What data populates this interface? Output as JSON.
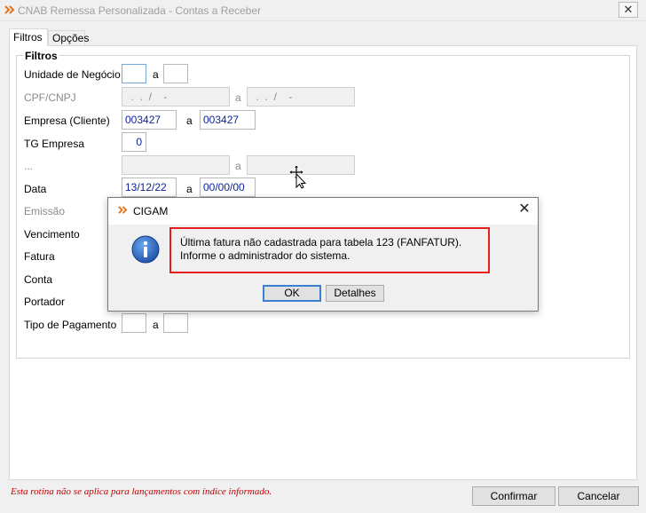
{
  "window": {
    "title": "CNAB Remessa Personalizada - Contas a Receber",
    "close_glyph": "✕"
  },
  "tabs": [
    {
      "label": "Filtros"
    },
    {
      "label": "Opções"
    }
  ],
  "group": {
    "legend": "Filtros"
  },
  "fields": [
    {
      "label": "Unidade de Negócio",
      "from": "",
      "to": ""
    },
    {
      "label": "CPF/CNPJ",
      "from": "  .  .  /    -",
      "to": "  .  .  /    -"
    },
    {
      "label": "Empresa (Cliente)",
      "from": "003427",
      "to": "003427"
    },
    {
      "label": "TG Empresa",
      "value": "0"
    },
    {
      "label": "...",
      "from": "",
      "to": ""
    },
    {
      "label": "Data",
      "from": "13/12/22",
      "to": "00/00/00"
    },
    {
      "label": "Emissão"
    },
    {
      "label": "Vencimento"
    },
    {
      "label": "Fatura"
    },
    {
      "label": "Conta"
    },
    {
      "label": "Portador"
    },
    {
      "label": "Tipo de Pagamento",
      "from": "",
      "to": ""
    }
  ],
  "range_separator": "a",
  "footer": {
    "note": "Esta rotina não se aplica para lançamentos com índice informado.",
    "confirm_label": "Confirmar",
    "cancel_label": "Cancelar"
  },
  "dialog": {
    "title": "CIGAM",
    "close_glyph": "✕",
    "message": "Última fatura não cadastrada para tabela 123 (FANFATUR). Informe o administrador do sistema.",
    "ok_label": "OK",
    "details_label": "Detalhes"
  },
  "colors": {
    "accent": "#e0701b",
    "highlight_border": "#e61d1d",
    "input_text": "#0a1f9c",
    "note_text": "#c00000"
  },
  "icons": {
    "app": "cigam-logo-icon",
    "info": "info-icon",
    "cursor": "move-cursor-icon"
  }
}
